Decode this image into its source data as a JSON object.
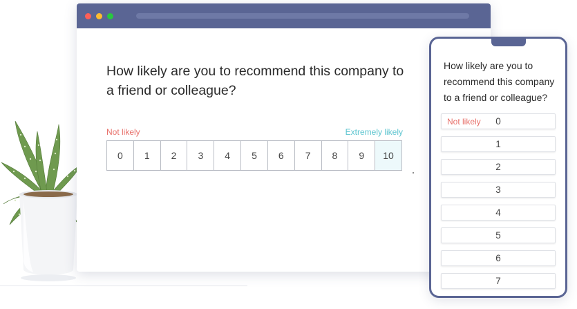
{
  "desktop": {
    "question": "How likely are you to recommend this company to a friend or colleague?",
    "low_label": "Not likely",
    "high_label": "Extremely likely",
    "scale": [
      "0",
      "1",
      "2",
      "3",
      "4",
      "5",
      "6",
      "7",
      "8",
      "9",
      "10"
    ],
    "selected": "10"
  },
  "mobile": {
    "question": "How likely are you to recommend this company to a friend or colleague?",
    "low_label": "Not likely",
    "options": [
      "0",
      "1",
      "2",
      "3",
      "4",
      "5",
      "6",
      "7"
    ]
  },
  "colors": {
    "window_bar": "#5a6594",
    "low_label": "#e8706a",
    "high_label": "#5bc4cf",
    "selected_cell": "#edf9fb"
  },
  "icons": {
    "plant": "succulent-plant-illustration",
    "window_controls": [
      "close-dot",
      "minimize-dot",
      "maximize-dot"
    ]
  }
}
